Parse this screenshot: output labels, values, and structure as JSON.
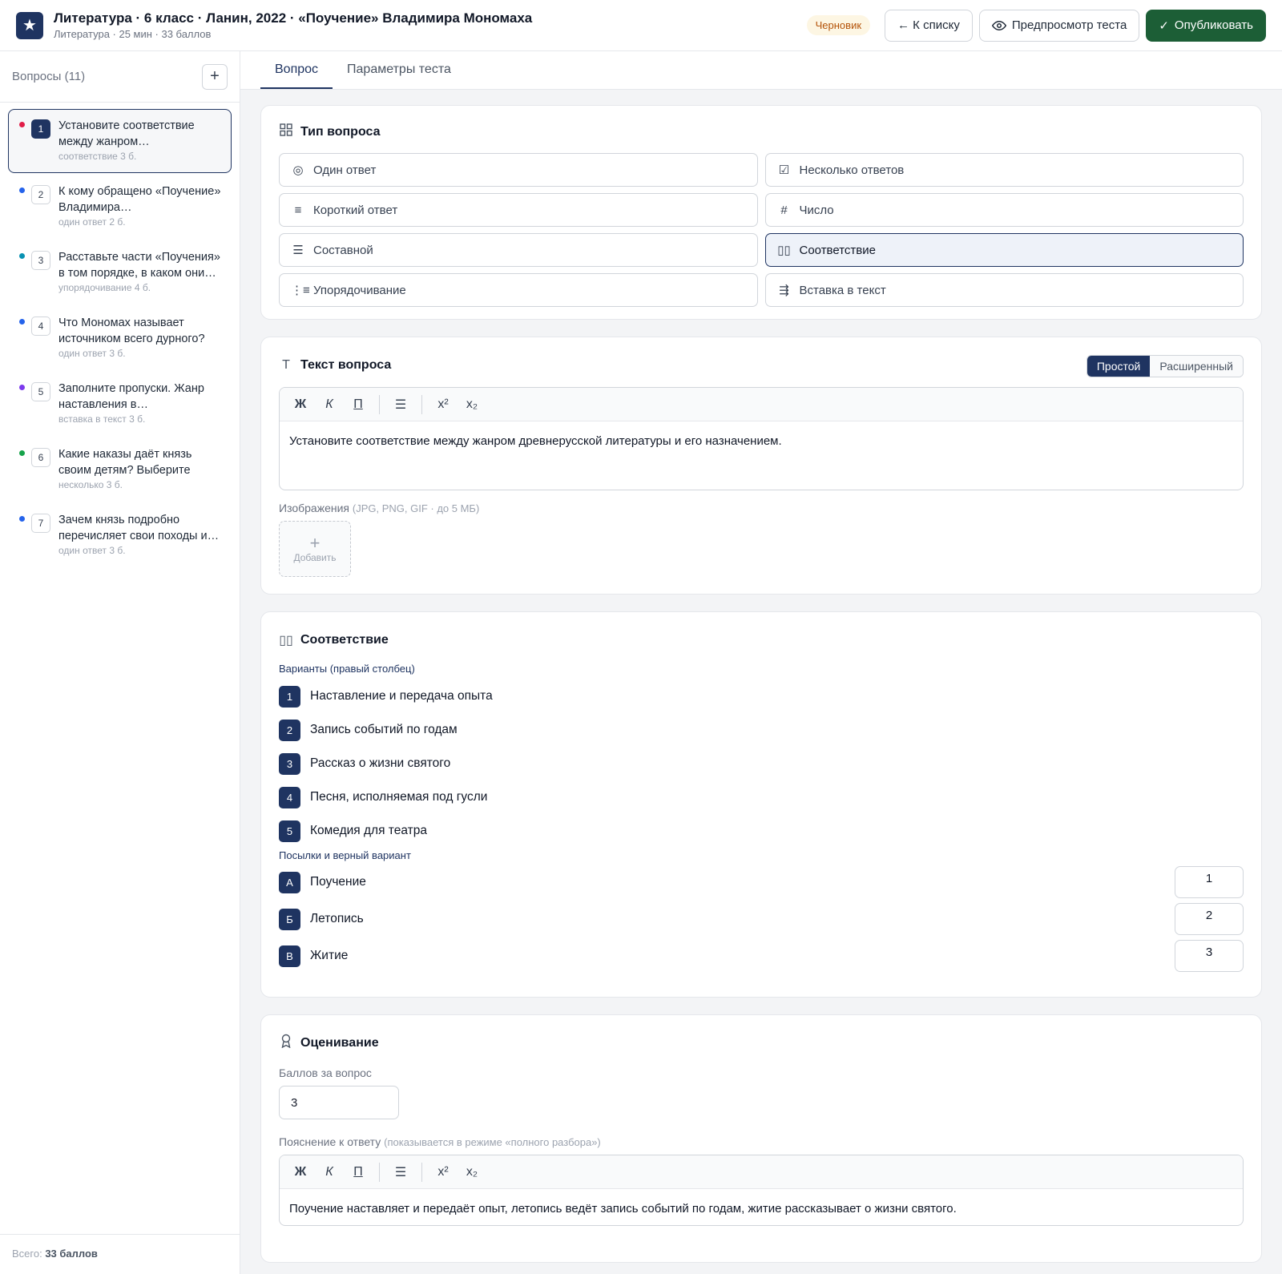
{
  "header": {
    "title": "Литература · 6 класс · Ланин, 2022 · «Поучение» Владимира Мономаха",
    "subtitle": "Литература · 25 мин · 33 баллов",
    "status": "Черновик",
    "back_label": "← К списку",
    "preview_label": "Предпросмотр теста",
    "publish_label": "Опубликовать"
  },
  "sidebar": {
    "heading": "Вопросы (11)",
    "add_label": "+",
    "questions": [
      {
        "num": "1",
        "text": "Установите соответствие между жанром…",
        "meta": "соответствие  3 б.",
        "color": "#e11d48"
      },
      {
        "num": "2",
        "text": "К кому обращено «Поучение» Владимира…",
        "meta": "один ответ  2 б.",
        "color": "#2563eb"
      },
      {
        "num": "3",
        "text": "Расставьте части «Поучения» в том порядке, в каком они…",
        "meta": "упорядочивание  4 б.",
        "color": "#0891b2"
      },
      {
        "num": "4",
        "text": "Что Мономах называет источником всего дурного?",
        "meta": "один ответ  3 б.",
        "color": "#2563eb"
      },
      {
        "num": "5",
        "text": "Заполните пропуски. Жанр наставления в…",
        "meta": "вставка в текст  3 б.",
        "color": "#7c3aed"
      },
      {
        "num": "6",
        "text": "Какие наказы даёт князь своим детям? Выберите все…",
        "meta": "несколько  3 б.",
        "color": "#16a34a"
      },
      {
        "num": "7",
        "text": "Зачем князь подробно перечисляет свои походы и…",
        "meta": "один ответ  3 б.",
        "color": "#2563eb"
      }
    ],
    "footer_prefix": "Всего: ",
    "footer_value": "33 баллов"
  },
  "tabs": [
    "Вопрос",
    "Параметры теста"
  ],
  "qtype": {
    "title": "Тип вопроса",
    "options": [
      "Один ответ",
      "Несколько ответов",
      "Короткий ответ",
      "Число",
      "Составной",
      "Соответствие",
      "Упорядочивание",
      "Вставка в текст"
    ]
  },
  "qtext": {
    "title": "Текст вопроса",
    "mode_simple": "Простой",
    "mode_extended": "Расширенный",
    "toolbar": {
      "bold": "Ж",
      "italic": "К",
      "underline": "П",
      "list": "☰",
      "sup": "x²",
      "sub": "x₂"
    },
    "text": "Установите соответствие между жанром древнерусской литературы и его назначением.",
    "images_label": "Изображения",
    "images_hint": "(JPG, PNG, GIF · до 5 МБ)",
    "add_label": "Добавить"
  },
  "matching": {
    "title": "Соответствие",
    "options_label": "Варианты (правый столбец)",
    "options": [
      {
        "num": "1",
        "text": "Наставление и передача опыта"
      },
      {
        "num": "2",
        "text": "Запись событий по годам"
      },
      {
        "num": "3",
        "text": "Рассказ о жизни святого"
      },
      {
        "num": "4",
        "text": "Песня, исполняемая под гусли"
      },
      {
        "num": "5",
        "text": "Комедия для театра"
      }
    ],
    "premises_label": "Посылки и верный вариант",
    "premises": [
      {
        "letter": "А",
        "text": "Поучение",
        "answer": "1"
      },
      {
        "letter": "Б",
        "text": "Летопись",
        "answer": "2"
      },
      {
        "letter": "В",
        "text": "Житие",
        "answer": "3"
      }
    ]
  },
  "grading": {
    "title": "Оценивание",
    "points_label": "Баллов за вопрос",
    "points_value": "3",
    "explain_label": "Пояснение к ответу",
    "explain_hint": "(показывается в режиме «полного разбора»)",
    "explain_text": "Поучение наставляет и передаёт опыт, летопись ведёт запись событий по годам, житие рассказывает о жизни святого."
  }
}
